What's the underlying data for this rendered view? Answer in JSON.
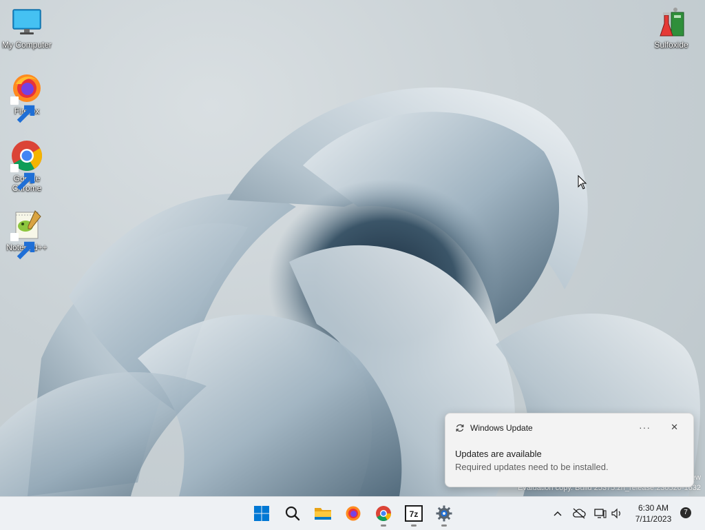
{
  "desktop": {
    "icons": [
      {
        "label": "My Computer"
      },
      {
        "label": "Firefox"
      },
      {
        "label": "Google Chrome"
      },
      {
        "label": "Notepad++"
      },
      {
        "label": "Sulfoxide"
      }
    ],
    "watermark_line1": "ew",
    "watermark_line2": "Evaluation copy. Build 25375.zn_release.230520-1632"
  },
  "notification": {
    "app_name": "Windows Update",
    "more_label": "···",
    "close_label": "✕",
    "title": "Updates are available",
    "body": "Required updates need to be installed."
  },
  "taskbar": {
    "apps": [
      "start-icon",
      "search-icon",
      "file-explorer-icon",
      "firefox-icon",
      "chrome-icon",
      "7zip-icon",
      "settings-icon"
    ],
    "sevenzip_label": "7z",
    "clock_time": "6:30 AM",
    "clock_date": "7/11/2023",
    "notification_count": "7"
  },
  "colors": {
    "taskbar_bg": "#eef1f4",
    "accent": "#0067c0",
    "toast_bg": "#f3f3f3"
  }
}
